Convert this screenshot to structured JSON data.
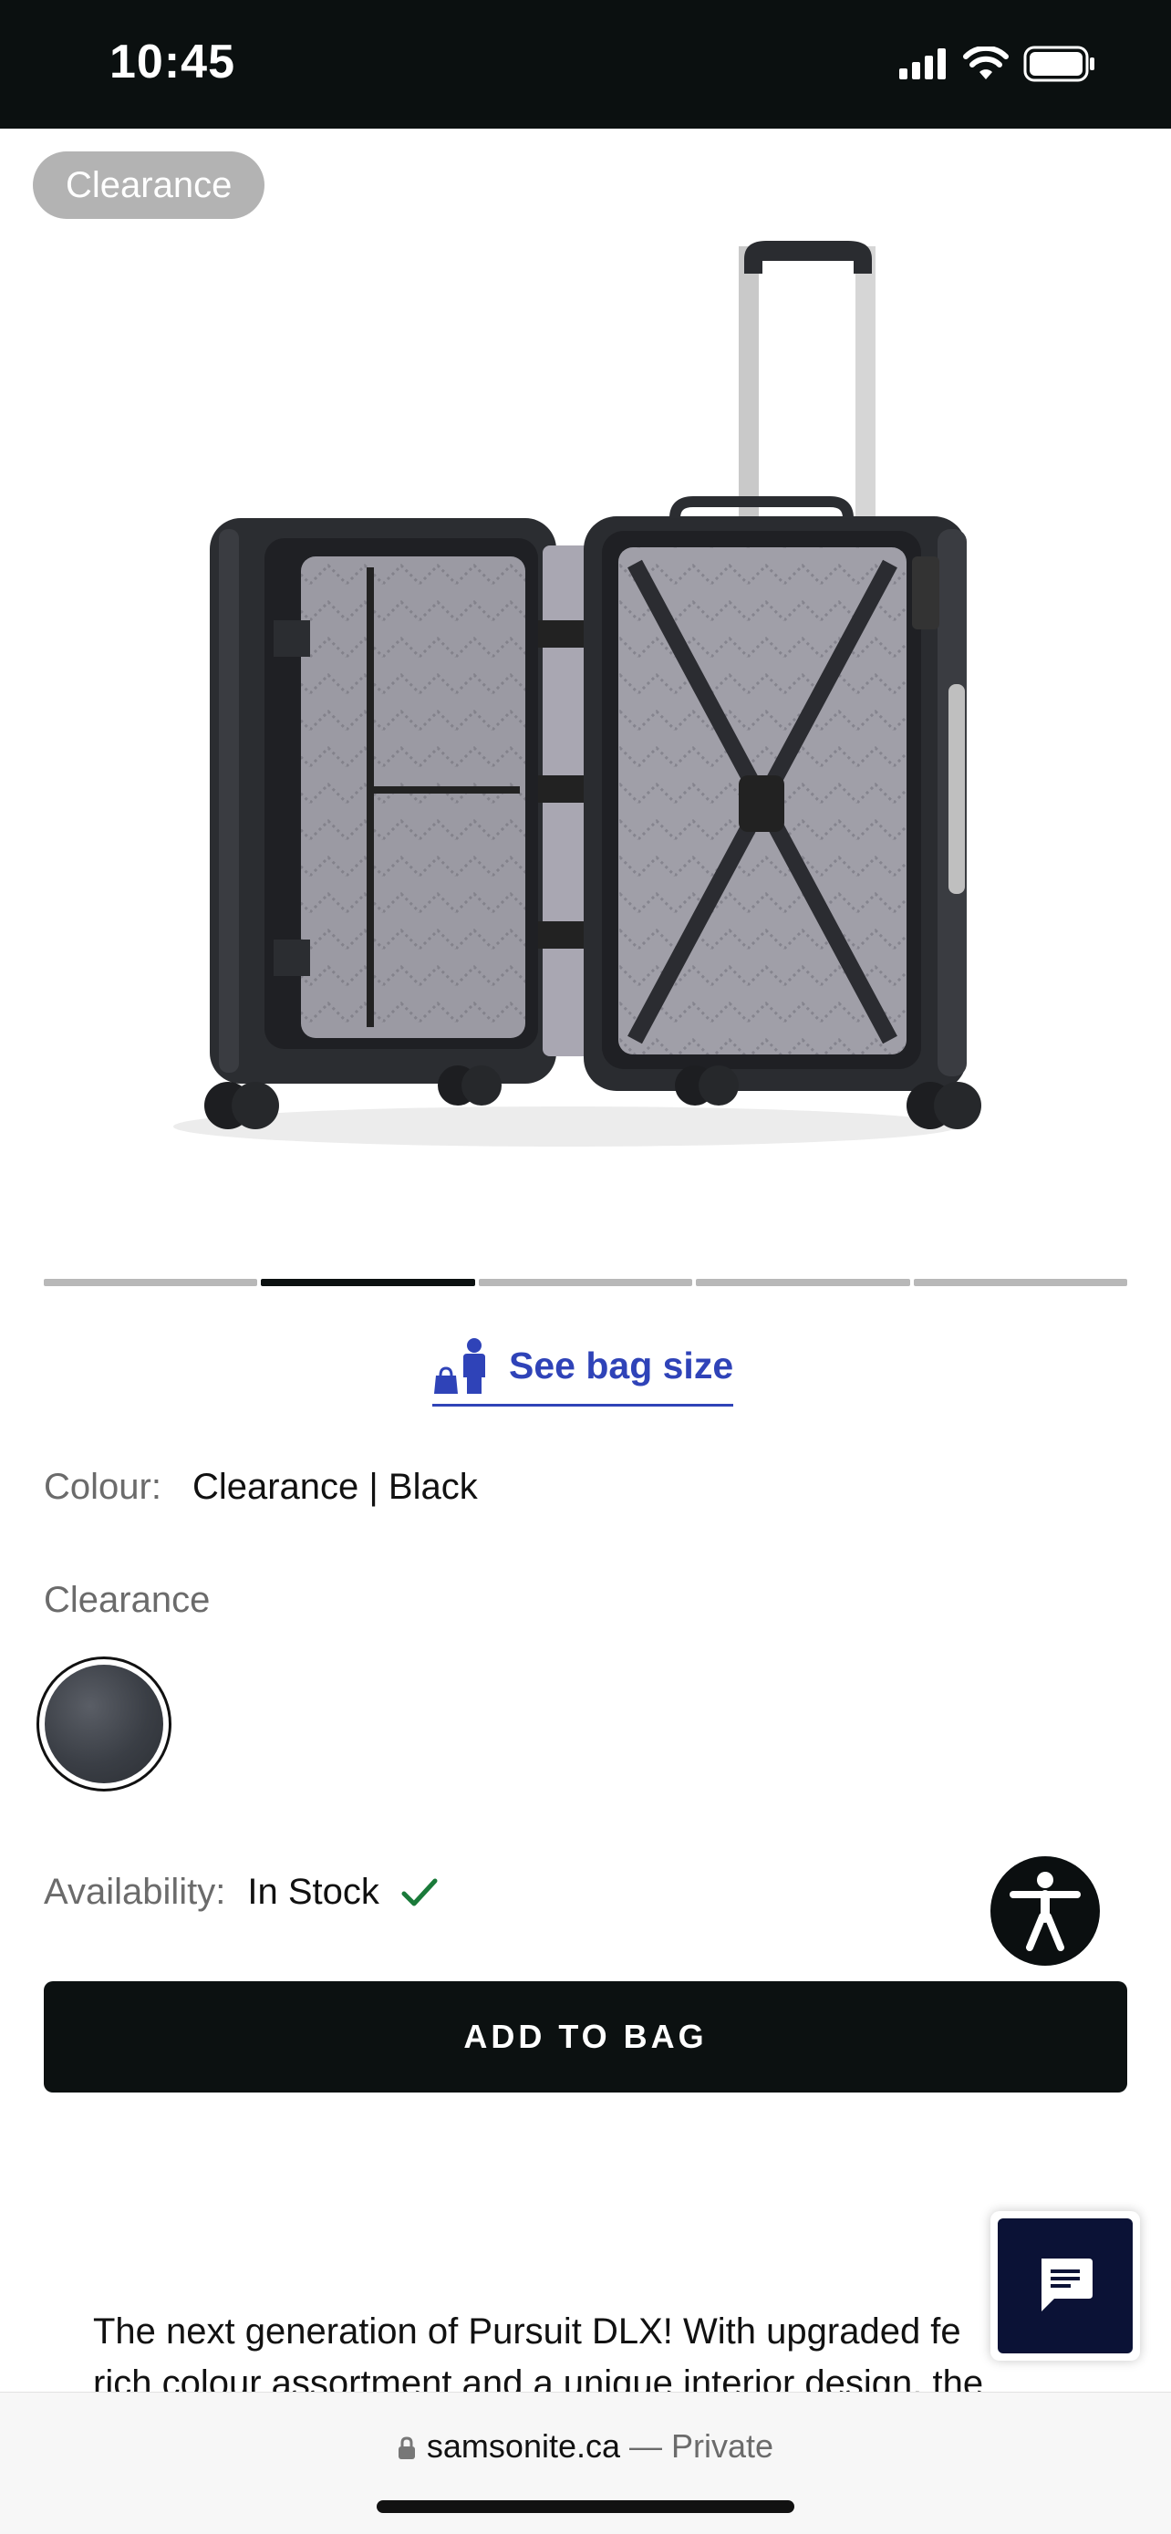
{
  "status_bar": {
    "time": "10:45"
  },
  "product": {
    "badge": "Clearance",
    "image_alt": "Open hardside spinner luggage",
    "carousel": {
      "count": 5,
      "active_index": 1
    }
  },
  "bag_size": {
    "label": "See bag size"
  },
  "colour": {
    "label": "Colour:",
    "value": "Clearance | Black"
  },
  "swatch_group": {
    "label": "Clearance",
    "selected_color": "#3a3e45"
  },
  "availability": {
    "label": "Availability:",
    "value": "In Stock"
  },
  "add_to_bag": {
    "label": "ADD TO BAG"
  },
  "description": {
    "line1": "The next generation of Pursuit DLX! With upgraded fe",
    "line2": "rich colour assortment and a unique interior design, the"
  },
  "browser": {
    "domain": "samsonite.ca",
    "separator": " — ",
    "mode": "Private"
  },
  "colors": {
    "accent_blue": "#2f43b8",
    "dark": "#0c1111",
    "chat_navy": "#0b1236",
    "check_green": "#1a7a3a"
  }
}
